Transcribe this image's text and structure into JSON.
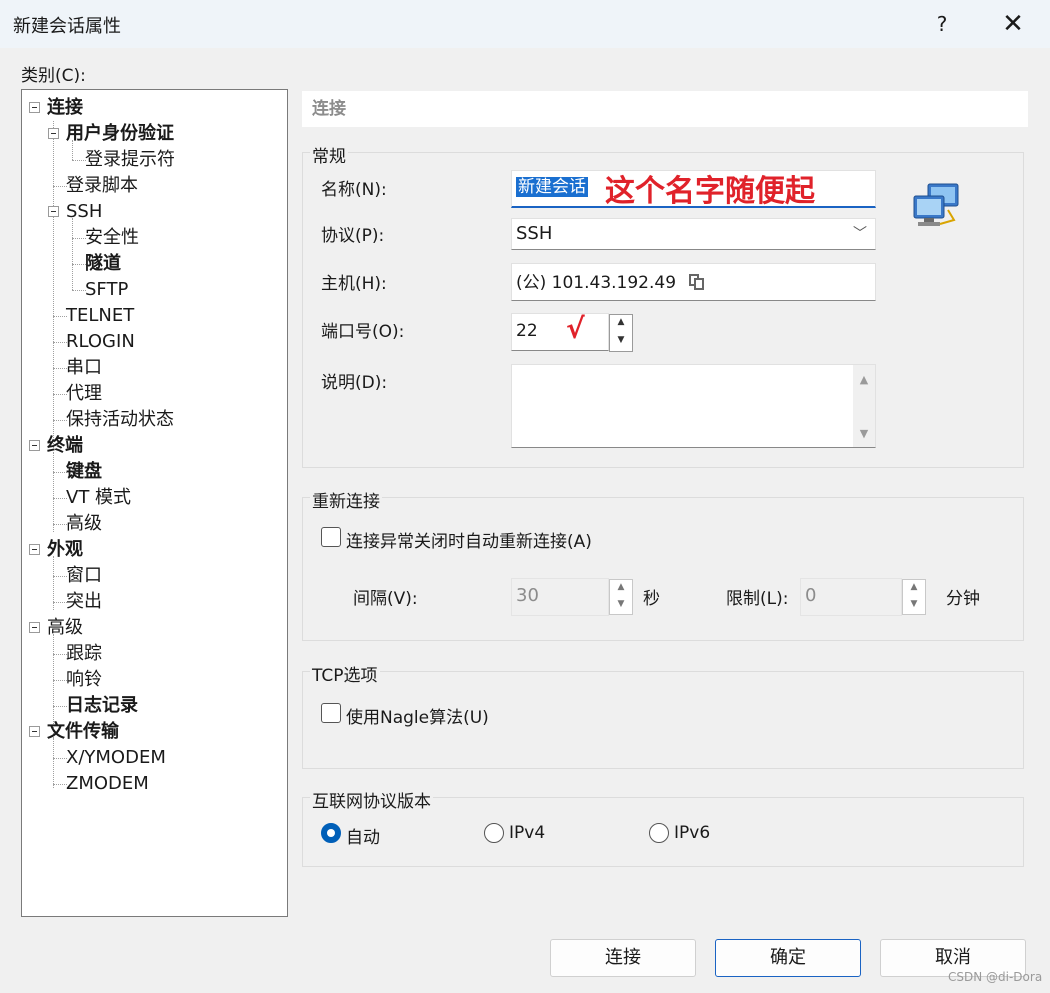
{
  "window": {
    "title": "新建会话属性",
    "help": "?",
    "close": "✕"
  },
  "category_label": "类别(C):",
  "tree": [
    {
      "label": "连接",
      "bold": true
    },
    {
      "label": "用户身份验证",
      "bold": true
    },
    {
      "label": "登录提示符",
      "bold": false
    },
    {
      "label": "登录脚本",
      "bold": false
    },
    {
      "label": "SSH",
      "bold": false
    },
    {
      "label": "安全性",
      "bold": false
    },
    {
      "label": "隧道",
      "bold": true
    },
    {
      "label": "SFTP",
      "bold": false
    },
    {
      "label": "TELNET",
      "bold": false
    },
    {
      "label": "RLOGIN",
      "bold": false
    },
    {
      "label": "串口",
      "bold": false
    },
    {
      "label": "代理",
      "bold": false
    },
    {
      "label": "保持活动状态",
      "bold": false
    },
    {
      "label": "终端",
      "bold": true
    },
    {
      "label": "键盘",
      "bold": true
    },
    {
      "label": "VT 模式",
      "bold": false
    },
    {
      "label": "高级",
      "bold": false
    },
    {
      "label": "外观",
      "bold": true
    },
    {
      "label": "窗口",
      "bold": false
    },
    {
      "label": "突出",
      "bold": false
    },
    {
      "label": "高级",
      "bold": false
    },
    {
      "label": "跟踪",
      "bold": false
    },
    {
      "label": "响铃",
      "bold": false
    },
    {
      "label": "日志记录",
      "bold": true
    },
    {
      "label": "文件传输",
      "bold": true
    },
    {
      "label": "X/YMODEM",
      "bold": false
    },
    {
      "label": "ZMODEM",
      "bold": false
    }
  ],
  "panel": {
    "header": "连接",
    "general": {
      "title": "常规",
      "name_label": "名称(N):",
      "name_value": "新建会话",
      "name_annotation": "这个名字随便起",
      "protocol_label": "协议(P):",
      "protocol_value": "SSH",
      "host_label": "主机(H):",
      "host_value": "(公) 101.43.192.49",
      "port_label": "端口号(O):",
      "port_value": "22",
      "port_annotation": "√",
      "desc_label": "说明(D):",
      "desc_value": ""
    },
    "reconnect": {
      "title": "重新连接",
      "auto_label": "连接异常关闭时自动重新连接(A)",
      "interval_label": "间隔(V):",
      "interval_value": "30",
      "interval_unit": "秒",
      "limit_label": "限制(L):",
      "limit_value": "0",
      "limit_unit": "分钟"
    },
    "tcp": {
      "title": "TCP选项",
      "nagle_label": "使用Nagle算法(U)"
    },
    "ip": {
      "title": "互联网协议版本",
      "auto": "自动",
      "ipv4": "IPv4",
      "ipv6": "IPv6",
      "selected": "auto"
    }
  },
  "buttons": {
    "connect": "连接",
    "ok": "确定",
    "cancel": "取消"
  },
  "watermark": "CSDN @di-Dora"
}
